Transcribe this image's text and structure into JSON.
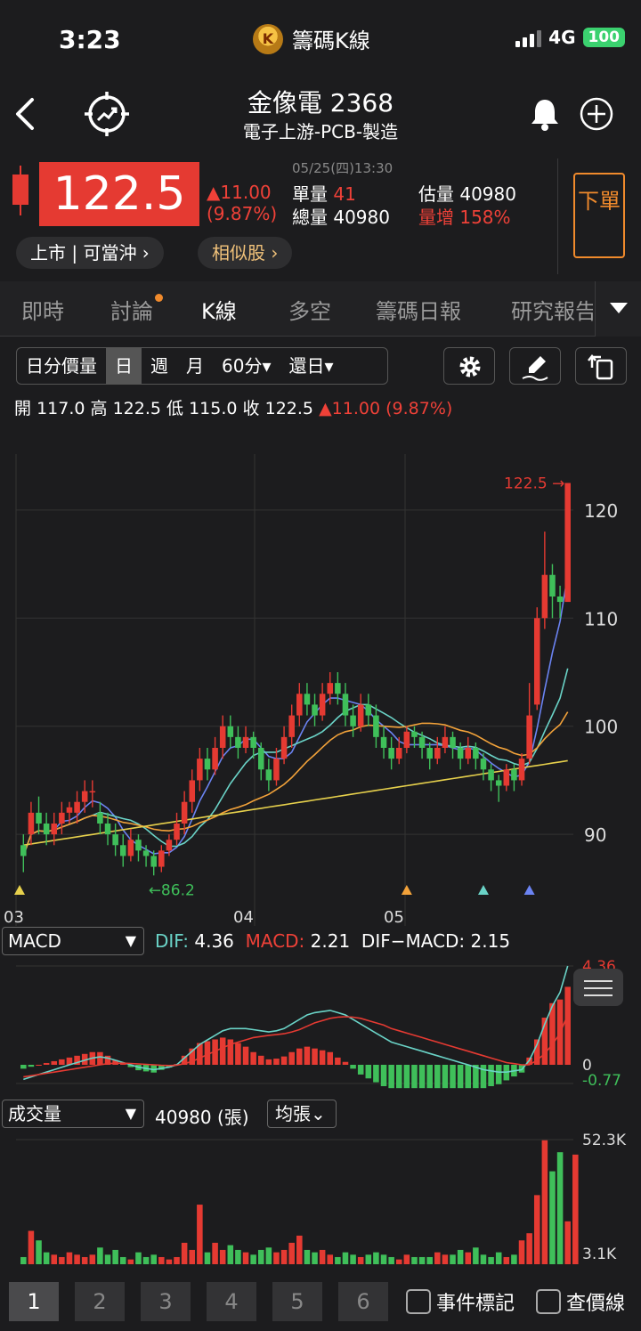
{
  "status_bar": {
    "time": "3:23",
    "app_name": "籌碼K線",
    "app_logo_letter": "K",
    "network": "4G",
    "battery": "100"
  },
  "header": {
    "stock_name": "金像電 2368",
    "category": "電子上游-PCB-製造"
  },
  "quote": {
    "price": "122.5",
    "change": "▲11.00",
    "change_pct": "(9.87%)",
    "datetime": "05/25(四)13:30",
    "unit_vol_label": "單量",
    "unit_vol": "41",
    "est_vol_label": "估量",
    "est_vol": "40980",
    "total_vol_label": "總量",
    "total_vol": "40980",
    "vol_inc_label": "量增",
    "vol_inc": "158%",
    "order_button": "下單",
    "market_pill": "上市 | 可當沖 ›",
    "similar_pill": "相似股 ›"
  },
  "tabs": [
    {
      "label": "即時"
    },
    {
      "label": "討論"
    },
    {
      "label": "K線"
    },
    {
      "label": "多空"
    },
    {
      "label": "籌碼日報"
    },
    {
      "label": "研究報告"
    }
  ],
  "toolbar": {
    "segments": [
      "日分價量",
      "日",
      "週",
      "月",
      "60分▾",
      "還日▾"
    ],
    "selected": "日"
  },
  "ohlc": {
    "open_label": "開",
    "open": "117.0",
    "high_label": "高",
    "high": "122.5",
    "low_label": "低",
    "low": "115.0",
    "close_label": "收",
    "close": "122.5",
    "change": "▲11.00 (9.87%)"
  },
  "indicators": {
    "macd_select": "MACD",
    "dif_label": "DIF:",
    "dif": "4.36",
    "macd_label": "MACD:",
    "macd": "2.21",
    "osc_label": "DIF−MACD:",
    "osc": "2.15",
    "macd_axis_top": "4.36",
    "macd_axis_zero": "0",
    "macd_axis_bottom": "-0.77",
    "volume_select": "成交量",
    "volume_value": "40980 (張)",
    "volume_mode": "均張⌄",
    "vol_axis_top": "52.3K",
    "vol_axis_bottom": "3.1K"
  },
  "chart_data": {
    "type": "candlestick",
    "y_ticks": [
      "120",
      "110",
      "100",
      "90"
    ],
    "x_ticks": [
      "03",
      "04",
      "05"
    ],
    "annotations": {
      "last_price": "122.5 →",
      "low_marker": "←86.2"
    },
    "ylim": [
      84,
      126
    ],
    "candles": [
      [
        89,
        88,
        90,
        86.5
      ],
      [
        90,
        92,
        93,
        89
      ],
      [
        92,
        91,
        93.5,
        90
      ],
      [
        91,
        90,
        92,
        89
      ],
      [
        90,
        91,
        92,
        89
      ],
      [
        91,
        92,
        93,
        90
      ],
      [
        92,
        92.5,
        93,
        91
      ],
      [
        92,
        93,
        94,
        91
      ],
      [
        93,
        94,
        95,
        92
      ],
      [
        94,
        94,
        95,
        92.5
      ],
      [
        92,
        91,
        93,
        90
      ],
      [
        91,
        90,
        92,
        89
      ],
      [
        90,
        89,
        91,
        88
      ],
      [
        89,
        88,
        90,
        87
      ],
      [
        88,
        89.5,
        90.5,
        87.5
      ],
      [
        89.5,
        88.5,
        90,
        87.5
      ],
      [
        88.5,
        88,
        89,
        87
      ],
      [
        88,
        87,
        88.5,
        86.2
      ],
      [
        87,
        88.5,
        89,
        86.5
      ],
      [
        88.5,
        89.5,
        90,
        88
      ],
      [
        89.5,
        91,
        92,
        89
      ],
      [
        91,
        93,
        94,
        90
      ],
      [
        93,
        95,
        96,
        92
      ],
      [
        95,
        97,
        98,
        94
      ],
      [
        97,
        96,
        98,
        95
      ],
      [
        96,
        98,
        99,
        95.5
      ],
      [
        98,
        100,
        101,
        97
      ],
      [
        100,
        99,
        101,
        98
      ],
      [
        99,
        98,
        100,
        97
      ],
      [
        98,
        99,
        100,
        97.5
      ],
      [
        99,
        98,
        99.5,
        97
      ],
      [
        98,
        96,
        98.5,
        95
      ],
      [
        96,
        95,
        97,
        94
      ],
      [
        95,
        97,
        98,
        94.5
      ],
      [
        97,
        99,
        100,
        96.5
      ],
      [
        99,
        101,
        102,
        98
      ],
      [
        101,
        103,
        104,
        100
      ],
      [
        103,
        102,
        104,
        101
      ],
      [
        102,
        101,
        103,
        100
      ],
      [
        101,
        103,
        104,
        100.5
      ],
      [
        103,
        104,
        105,
        102
      ],
      [
        104,
        103,
        105,
        102
      ],
      [
        103,
        101,
        104,
        100
      ],
      [
        101,
        100,
        102,
        99
      ],
      [
        100,
        102,
        103,
        99.5
      ],
      [
        102,
        101,
        103,
        100
      ],
      [
        101,
        99,
        102,
        98
      ],
      [
        99,
        98,
        100,
        97
      ],
      [
        98,
        97,
        99,
        96
      ],
      [
        97,
        98,
        99,
        96.5
      ],
      [
        98,
        99.5,
        100,
        97.5
      ],
      [
        99.5,
        99,
        100,
        98
      ],
      [
        99,
        98,
        99.5,
        97
      ],
      [
        98,
        97,
        98.5,
        96
      ],
      [
        97,
        98,
        99,
        96.5
      ],
      [
        98,
        99,
        100,
        97.5
      ],
      [
        99,
        98,
        99.5,
        97
      ],
      [
        98,
        97,
        98.5,
        96
      ],
      [
        97,
        98,
        99,
        96.5
      ],
      [
        98,
        97,
        98.5,
        96
      ],
      [
        97,
        96,
        97.5,
        95
      ],
      [
        96,
        95,
        96.5,
        94
      ],
      [
        95,
        94.5,
        95.5,
        93
      ],
      [
        94.5,
        96,
        96.5,
        94
      ],
      [
        96,
        95,
        96.5,
        94
      ],
      [
        95,
        97,
        97.5,
        94.5
      ],
      [
        97,
        101,
        104,
        96.5
      ],
      [
        102,
        110,
        111,
        101.5
      ],
      [
        110,
        114,
        118,
        109
      ],
      [
        114,
        112,
        115,
        110
      ],
      [
        112,
        111.5,
        113,
        110
      ],
      [
        111.5,
        122.5,
        122.5,
        115
      ]
    ],
    "ma_series": [
      {
        "color": "#6b83f2"
      },
      {
        "color": "#6ad3c7"
      },
      {
        "color": "#f2a23a"
      },
      {
        "color": "#e6d04c"
      }
    ],
    "macd_dif": [
      -0.6,
      -0.5,
      -0.4,
      -0.3,
      -0.2,
      -0.1,
      0,
      0.1,
      0.2,
      0.3,
      0.35,
      0.3,
      0.2,
      0.1,
      0,
      -0.1,
      -0.15,
      -0.2,
      -0.15,
      -0.1,
      0,
      0.3,
      0.6,
      0.9,
      1.1,
      1.3,
      1.5,
      1.6,
      1.6,
      1.6,
      1.55,
      1.5,
      1.45,
      1.5,
      1.6,
      1.8,
      2.0,
      2.2,
      2.3,
      2.35,
      2.4,
      2.3,
      2.2,
      2.0,
      1.8,
      1.6,
      1.4,
      1.2,
      1.0,
      0.9,
      0.8,
      0.7,
      0.6,
      0.5,
      0.4,
      0.3,
      0.2,
      0.1,
      0,
      -0.1,
      -0.2,
      -0.25,
      -0.3,
      -0.3,
      -0.25,
      -0.2,
      0.2,
      0.9,
      1.8,
      2.6,
      3.2,
      4.36
    ],
    "macd_signal": [
      -0.5,
      -0.45,
      -0.4,
      -0.35,
      -0.3,
      -0.25,
      -0.2,
      -0.15,
      -0.1,
      -0.05,
      0,
      0.05,
      0.07,
      0.07,
      0.06,
      0.04,
      0.02,
      0,
      -0.02,
      -0.03,
      -0.02,
      0.05,
      0.15,
      0.3,
      0.45,
      0.6,
      0.75,
      0.9,
      1.0,
      1.1,
      1.2,
      1.25,
      1.3,
      1.33,
      1.37,
      1.45,
      1.55,
      1.7,
      1.85,
      1.95,
      2.05,
      2.1,
      2.12,
      2.1,
      2.05,
      1.95,
      1.85,
      1.75,
      1.6,
      1.5,
      1.4,
      1.3,
      1.2,
      1.1,
      1.0,
      0.9,
      0.8,
      0.7,
      0.6,
      0.5,
      0.4,
      0.3,
      0.2,
      0.1,
      0.05,
      0,
      0,
      0.2,
      0.5,
      0.9,
      1.4,
      2.21
    ],
    "volume": [
      3,
      14,
      10,
      5,
      4,
      3,
      5,
      4,
      3,
      4,
      7,
      4,
      6,
      3,
      2,
      5,
      3,
      4,
      3,
      2,
      3,
      9,
      6,
      25,
      5,
      9,
      6,
      8,
      6,
      5,
      4,
      6,
      7,
      5,
      6,
      9,
      12,
      6,
      5,
      6,
      4,
      3,
      5,
      4,
      3,
      4,
      5,
      4,
      3,
      2,
      4,
      3,
      3,
      3,
      5,
      4,
      4,
      6,
      5,
      7,
      4,
      3,
      5,
      3,
      4,
      10,
      13,
      29,
      52,
      39,
      47,
      18,
      46
    ]
  }
}
